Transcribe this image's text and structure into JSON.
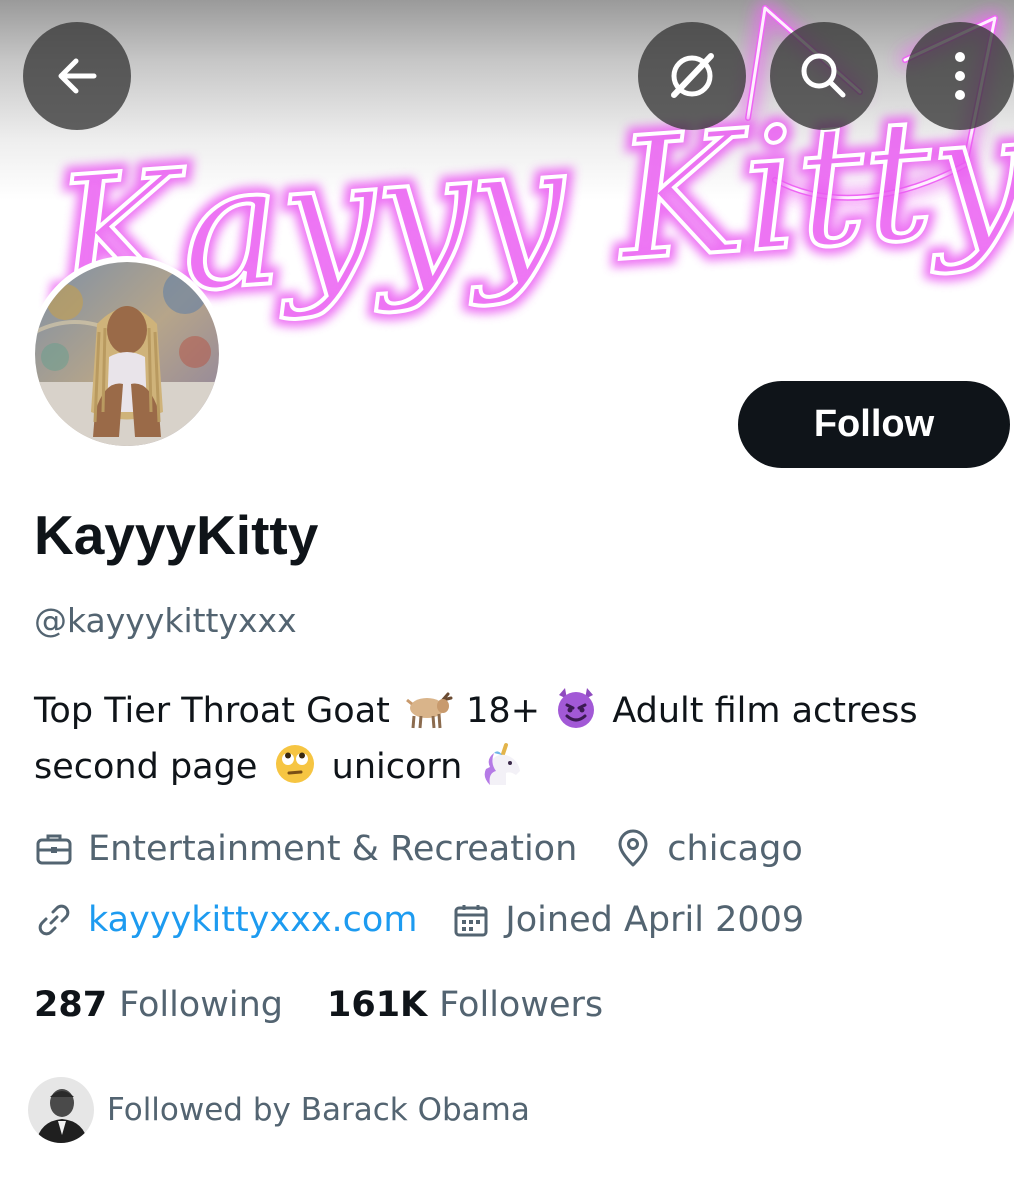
{
  "header": {
    "banner_text": "Kayyy Kitty",
    "icons": [
      "back-arrow-icon",
      "grok-icon",
      "search-icon",
      "more-vertical-icon"
    ]
  },
  "profile": {
    "follow_label": "Follow",
    "display_name": "KayyyKitty",
    "handle": "@kayyykittyxxx",
    "bio": {
      "line1_part1": "Top Tier Throat Goat",
      "line1_emoji1": "goat-emoji",
      "line1_part2": "18+",
      "line1_emoji2": "smiling-devil-emoji",
      "line1_part3": "Adult film actress",
      "line2_part1": "second page",
      "line2_emoji1": "eye-roll-emoji",
      "line2_part2": "unicorn",
      "line2_emoji2": "unicorn-emoji"
    },
    "category": "Entertainment & Recreation",
    "location": "chicago",
    "website": "kayyykittyxxx.com",
    "joined": "Joined April 2009",
    "following_count": "287",
    "following_label": "Following",
    "followers_count": "161K",
    "followers_label": "Followers",
    "followed_by": "Followed by Barack Obama"
  },
  "colors": {
    "text": "#0f1419",
    "secondary": "#536471",
    "link": "#1d9bf0",
    "neon_pink": "#e65cf0"
  }
}
